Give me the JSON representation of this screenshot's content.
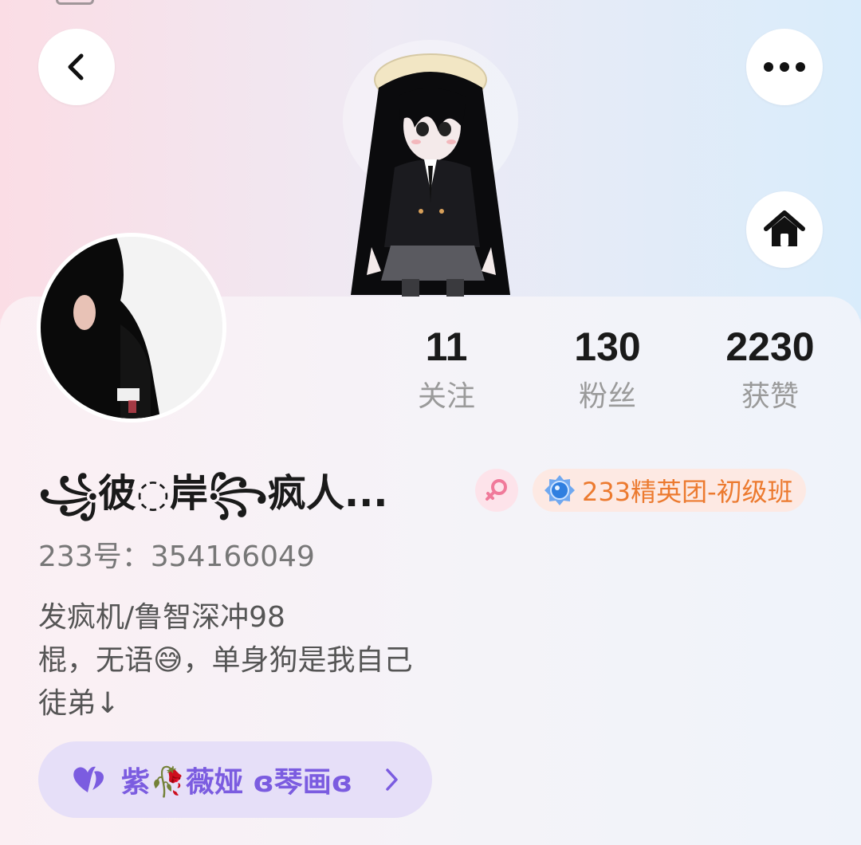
{
  "header": {
    "back_icon": "chevron-left-icon",
    "more_icon": "more-horizontal-icon",
    "home_icon": "home-icon"
  },
  "profile": {
    "nickname": "꧁彼◌岸꧂疯人...",
    "uid_label": "233号：354166049",
    "gender": "female",
    "tag_badge": {
      "icon": "elite-medal-icon",
      "text": "233精英团-初级班"
    },
    "bio_lines": [
      "发疯机/鲁智深冲98",
      "棍，无语😅，单身狗是我自己",
      "徒弟↓"
    ]
  },
  "stats": [
    {
      "value": "11",
      "label": "关注"
    },
    {
      "value": "130",
      "label": "粉丝"
    },
    {
      "value": "2230",
      "label": "获赞"
    }
  ],
  "relation": {
    "icon": "heart-icon",
    "text": "紫🥀薇娅 ɞ琴画ɞ"
  },
  "colors": {
    "tag_text": "#ec7a2f",
    "relation_text": "#7b5ce0",
    "gender_pink": "#f07a9a"
  }
}
